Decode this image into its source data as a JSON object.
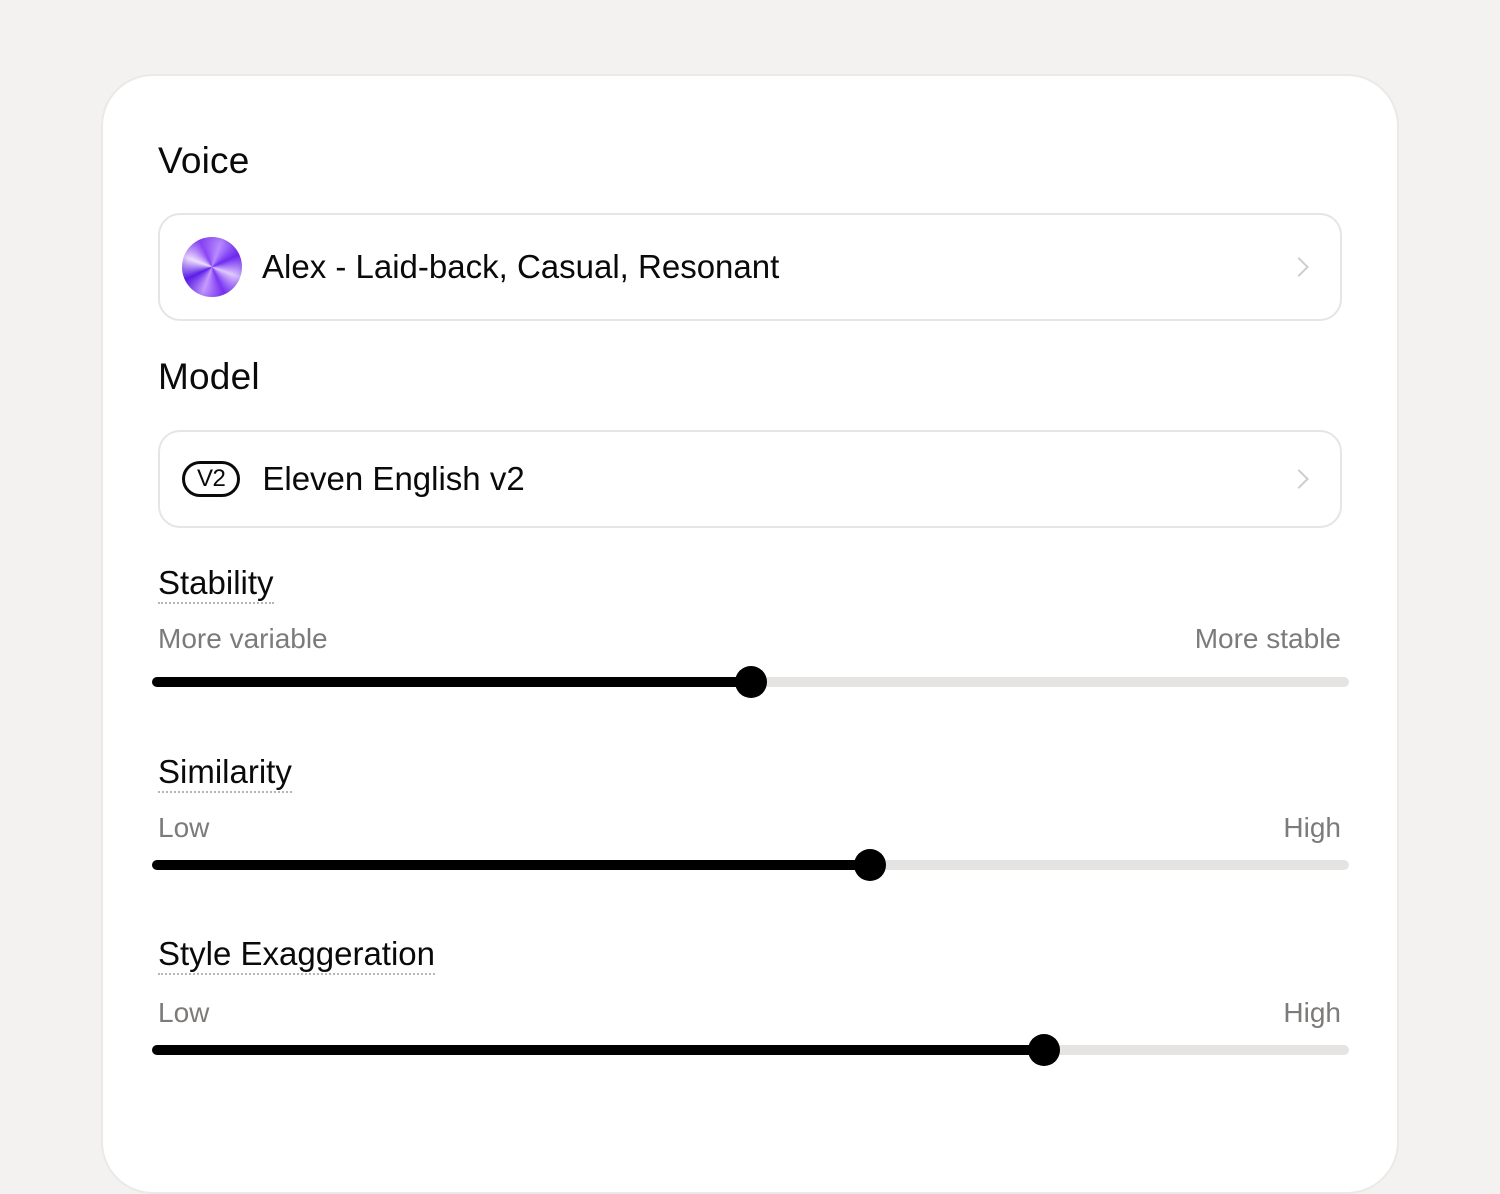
{
  "voice": {
    "label": "Voice",
    "selected": "Alex - Laid-back, Casual, Resonant",
    "avatar_icon": "gradient-orb-avatar",
    "accent": "#7a35f2"
  },
  "model": {
    "label": "Model",
    "badge": "V2",
    "selected": "Eleven English v2"
  },
  "sliders": [
    {
      "name": "Stability",
      "min_label": "More variable",
      "max_label": "More stable",
      "value": 0.5
    },
    {
      "name": "Similarity",
      "min_label": "Low",
      "max_label": "High",
      "value": 0.6
    },
    {
      "name": "Style Exaggeration",
      "min_label": "Low",
      "max_label": "High",
      "value": 0.745
    }
  ]
}
